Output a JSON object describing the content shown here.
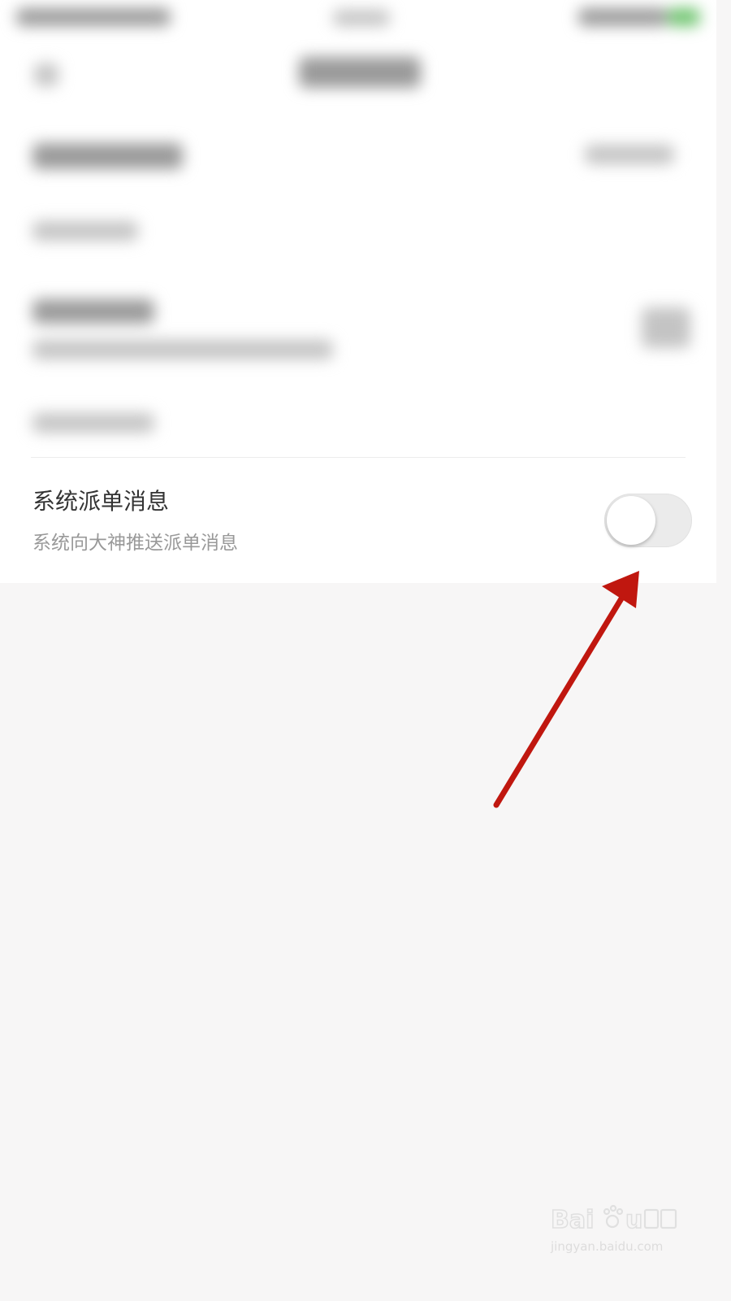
{
  "setting": {
    "title": "系统派单消息",
    "description": "系统向大神推送派单消息",
    "enabled": false
  },
  "watermark": {
    "url": "jingyan.baidu.com"
  },
  "colors": {
    "annotation_arrow": "#c0170f",
    "toggle_off_track": "#ebebeb",
    "page_background": "#f7f6f6"
  }
}
